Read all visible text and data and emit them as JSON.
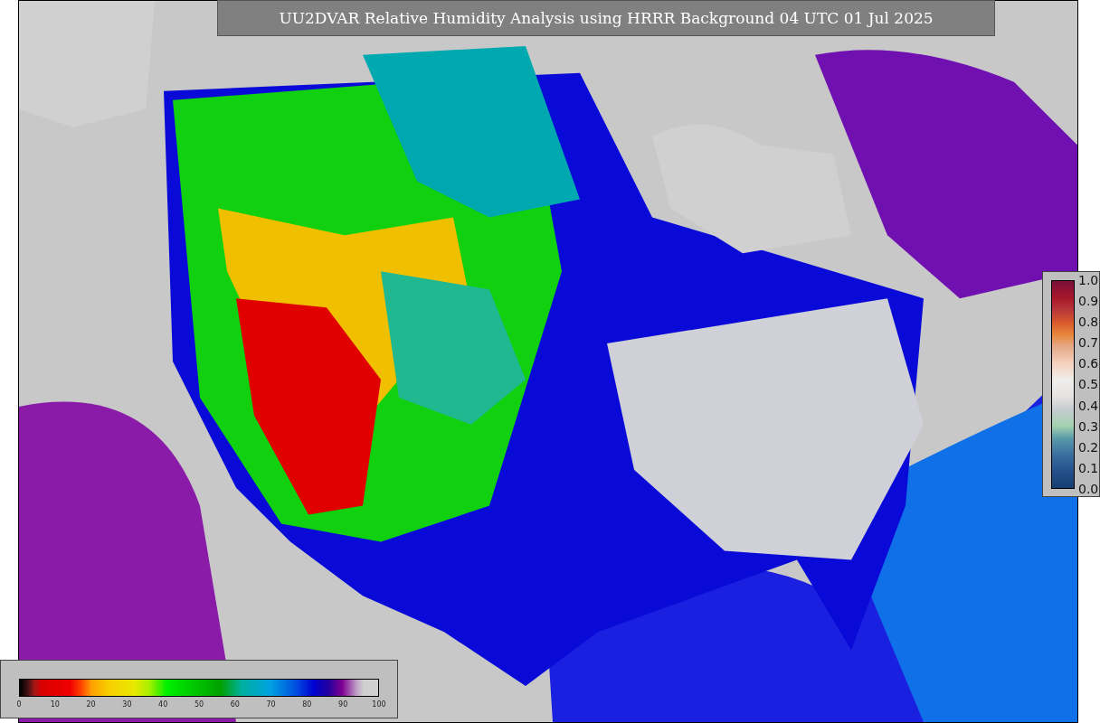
{
  "title": "UU2DVAR Relative Humidity Analysis using HRRR Background 04 UTC 01 Jul 2025",
  "side_legend": {
    "ticks": [
      "1.0",
      "0.9",
      "0.8",
      "0.7",
      "0.6",
      "0.5",
      "0.4",
      "0.3",
      "0.2",
      "0.1",
      "0.0"
    ]
  },
  "bottom_legend": {
    "ticks": [
      "0",
      "10",
      "20",
      "30",
      "40",
      "50",
      "60",
      "70",
      "80",
      "90",
      "100"
    ]
  }
}
